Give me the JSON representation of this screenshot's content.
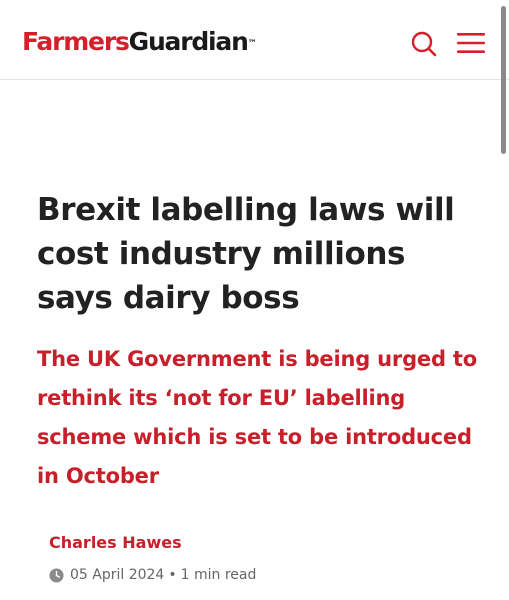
{
  "header": {
    "logo_part1": "Farmers",
    "logo_part2": "Guardian",
    "logo_tm": "™",
    "brand_red": "#d4202a",
    "icons": [
      "search-icon",
      "hamburger-menu-icon"
    ]
  },
  "article": {
    "headline": "Brexit labelling laws will cost industry millions says dairy boss",
    "standfirst": "The UK Government is being urged to rethink its ‘not for EU’ labelling scheme which is set to be introduced in October",
    "author": "Charles Hawes",
    "date": "05 April 2024",
    "separator": "•",
    "read_time": "1 min read",
    "accent_color": "#c8202b"
  }
}
